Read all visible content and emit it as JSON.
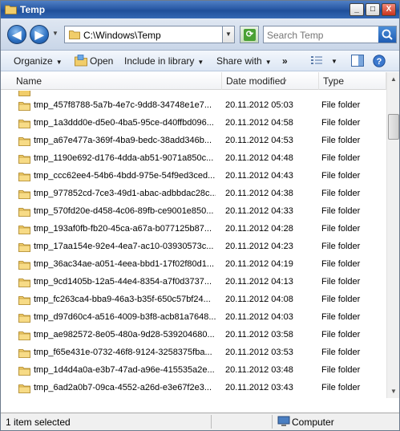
{
  "window": {
    "title": "Temp",
    "buttons": {
      "minimize": "_",
      "maximize": "□",
      "close": "X"
    }
  },
  "address": {
    "path": "C:\\Windows\\Temp",
    "search_placeholder": "Search Temp"
  },
  "toolbar": {
    "organize": "Organize",
    "open": "Open",
    "include_in_library": "Include in library",
    "share_with": "Share with",
    "more": "»"
  },
  "columns": {
    "name": "Name",
    "date_modified": "Date modified",
    "type": "Type"
  },
  "rows": [
    {
      "name": "tmp_457f8788-5a7b-4e7c-9dd8-34748e1e7...",
      "date": "20.11.2012 05:03",
      "type": "File folder"
    },
    {
      "name": "tmp_1a3ddd0e-d5e0-4ba5-95ce-d40ffbd096...",
      "date": "20.11.2012 04:58",
      "type": "File folder"
    },
    {
      "name": "tmp_a67e477a-369f-4ba9-bedc-38add346b...",
      "date": "20.11.2012 04:53",
      "type": "File folder"
    },
    {
      "name": "tmp_1190e692-d176-4dda-ab51-9071a850c...",
      "date": "20.11.2012 04:48",
      "type": "File folder"
    },
    {
      "name": "tmp_ccc62ee4-54b6-4bdd-975e-54f9ed3ced...",
      "date": "20.11.2012 04:43",
      "type": "File folder"
    },
    {
      "name": "tmp_977852cd-7ce3-49d1-abac-adbbdac28c...",
      "date": "20.11.2012 04:38",
      "type": "File folder"
    },
    {
      "name": "tmp_570fd20e-d458-4c06-89fb-ce9001e850...",
      "date": "20.11.2012 04:33",
      "type": "File folder"
    },
    {
      "name": "tmp_193af0fb-fb20-45ca-a67a-b077125b87...",
      "date": "20.11.2012 04:28",
      "type": "File folder"
    },
    {
      "name": "tmp_17aa154e-92e4-4ea7-ac10-03930573c...",
      "date": "20.11.2012 04:23",
      "type": "File folder"
    },
    {
      "name": "tmp_36ac34ae-a051-4eea-bbd1-17f02f80d1...",
      "date": "20.11.2012 04:19",
      "type": "File folder"
    },
    {
      "name": "tmp_9cd1405b-12a5-44e4-8354-a7f0d3737...",
      "date": "20.11.2012 04:13",
      "type": "File folder"
    },
    {
      "name": "tmp_fc263ca4-bba9-46a3-b35f-650c57bf24...",
      "date": "20.11.2012 04:08",
      "type": "File folder"
    },
    {
      "name": "tmp_d97d60c4-a516-4009-b3f8-acb81a7648...",
      "date": "20.11.2012 04:03",
      "type": "File folder"
    },
    {
      "name": "tmp_ae982572-8e05-480a-9d28-539204680...",
      "date": "20.11.2012 03:58",
      "type": "File folder"
    },
    {
      "name": "tmp_f65e431e-0732-46f8-9124-3258375fba...",
      "date": "20.11.2012 03:53",
      "type": "File folder"
    },
    {
      "name": "tmp_1d4d4a0a-e3b7-47ad-a96e-415535a2e...",
      "date": "20.11.2012 03:48",
      "type": "File folder"
    },
    {
      "name": "tmp_6ad2a0b7-09ca-4552-a26d-e3e67f2e3...",
      "date": "20.11.2012 03:43",
      "type": "File folder"
    }
  ],
  "status": {
    "selection": "1 item selected",
    "location": "Computer"
  },
  "colors": {
    "titlebar": "#2a5aa6",
    "folder": "#e8c15a",
    "address_bg": "#dfe7f2"
  },
  "icons": [
    "folder-icon",
    "back-arrow-icon",
    "forward-arrow-icon",
    "refresh-icon",
    "search-icon",
    "open-icon",
    "views-icon",
    "preview-pane-icon",
    "help-icon",
    "computer-icon"
  ]
}
